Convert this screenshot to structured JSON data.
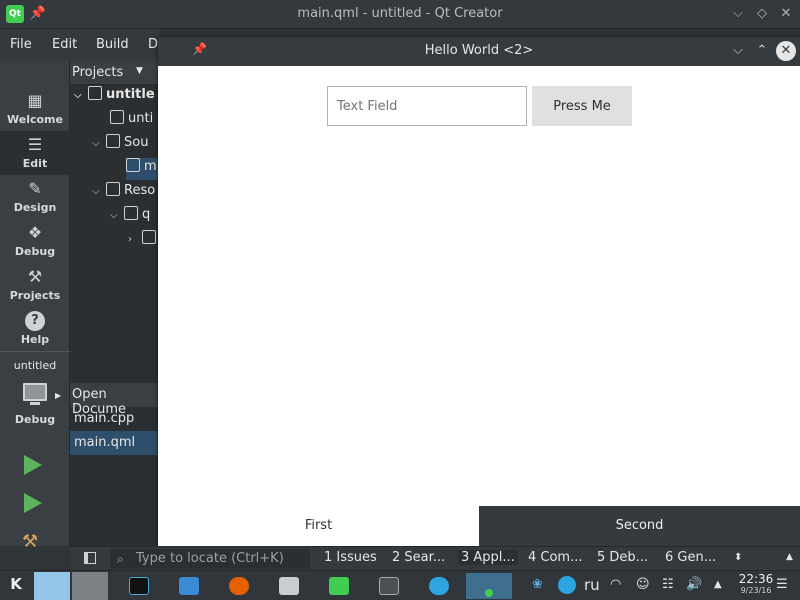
{
  "window": {
    "title": "main.qml - untitled - Qt Creator",
    "logo_text": "Qt",
    "pin_icon": "pin-icon",
    "minimize_icon": "chevron-down-icon",
    "maximize_icon": "diamond-icon",
    "close_icon": "close-icon"
  },
  "menu": {
    "items": [
      "File",
      "Edit",
      "Build",
      "D"
    ]
  },
  "modes": [
    {
      "label": "Welcome",
      "icon": "grid-icon"
    },
    {
      "label": "Edit",
      "icon": "edit-icon",
      "active": true
    },
    {
      "label": "Design",
      "icon": "pencil-icon"
    },
    {
      "label": "Debug",
      "icon": "bug-icon"
    },
    {
      "label": "Projects",
      "icon": "wrench-icon"
    },
    {
      "label": "Help",
      "icon": "help-icon"
    }
  ],
  "kit": {
    "project": "untitled",
    "config": "Debug"
  },
  "projects_pane": {
    "header": "Projects",
    "tree": [
      "untitle",
      "unti",
      "Sou",
      "m",
      "Reso",
      "q",
      ""
    ]
  },
  "open_documents": {
    "header": "Open Docume",
    "items": [
      "main.cpp",
      "main.qml"
    ],
    "selected": "main.qml"
  },
  "hello_window": {
    "title": "Hello World <2>",
    "text_field_placeholder": "Text Field",
    "button_label": "Press Me",
    "tabs": [
      "First",
      "Second"
    ],
    "active_tab": "First"
  },
  "output_bar": {
    "locator_placeholder": "Type to locate (Ctrl+K)",
    "tabs": [
      "1  Issues",
      "2  Sear...",
      "3  Appl...",
      "4  Com...",
      "5  Deb...",
      "6  Gen..."
    ],
    "active_tab": "3  Appl..."
  },
  "taskbar": {
    "apps": [
      "kde-menu-icon",
      "desktop-1-icon",
      "desktop-2-icon",
      "clion-icon",
      "file-manager-icon",
      "firefox-icon",
      "code-icon",
      "qt-creator-icon",
      "terminal-icon",
      "telegram-icon",
      "qml-app-icon"
    ],
    "language": "ru",
    "time": "22:36",
    "date": "9/23/16",
    "colors": {
      "active_desktop": "#93c6e8",
      "inactive_desktop": "#7d8084",
      "telegram": "#2ca5e0",
      "firefox": "#e66000",
      "qt": "#41cd52"
    }
  }
}
